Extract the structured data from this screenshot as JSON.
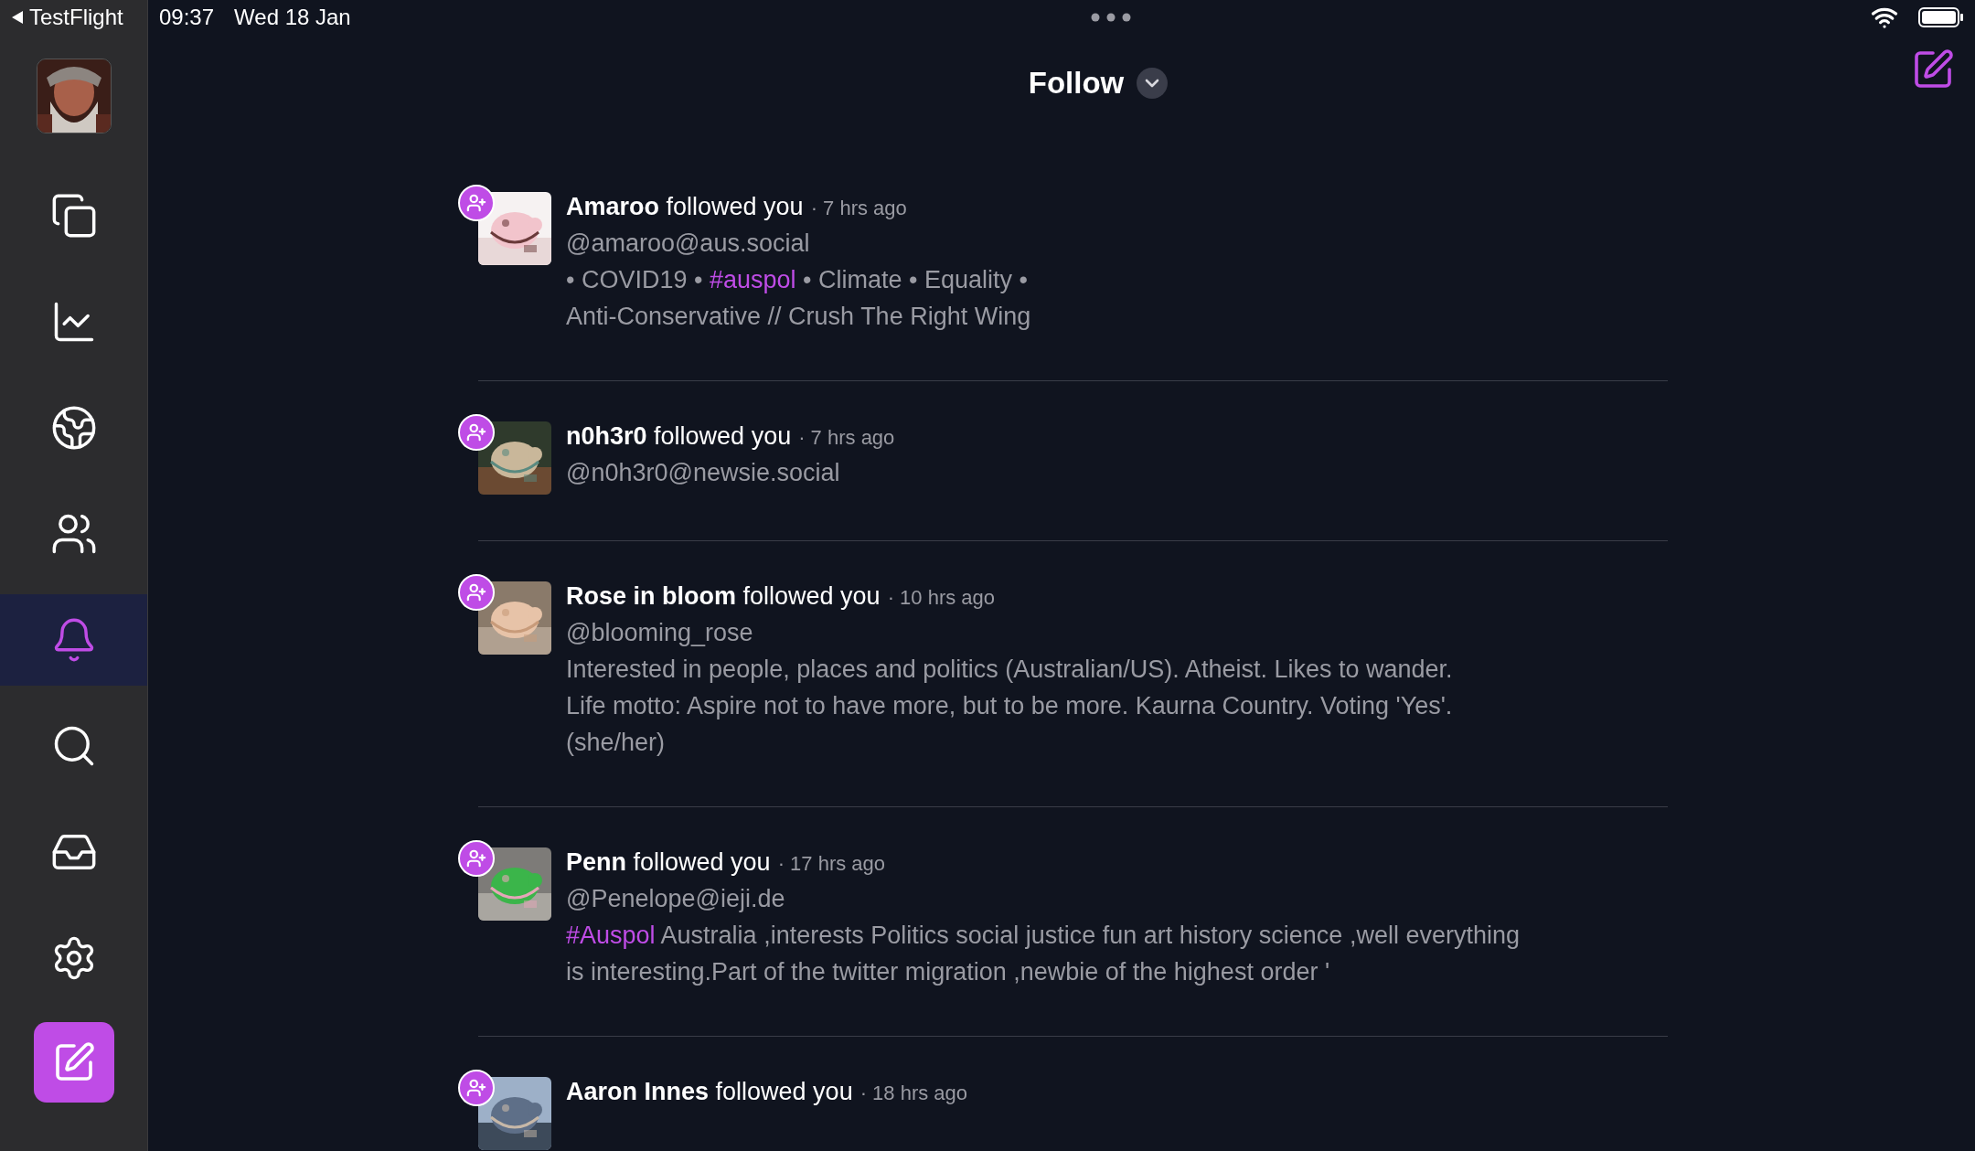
{
  "status_bar": {
    "back_label": "TestFlight",
    "time": "09:37",
    "date": "Wed 18 Jan"
  },
  "header": {
    "title": "Follow"
  },
  "sidebar": {
    "items": [
      {
        "kind": "timelines",
        "selected": false
      },
      {
        "kind": "trending",
        "selected": false
      },
      {
        "kind": "explore",
        "selected": false
      },
      {
        "kind": "people",
        "selected": false
      },
      {
        "kind": "notifications",
        "selected": true
      },
      {
        "kind": "search",
        "selected": false
      },
      {
        "kind": "inbox",
        "selected": false
      },
      {
        "kind": "settings",
        "selected": false
      }
    ]
  },
  "notifications": [
    {
      "name": "Amaroo",
      "action": "followed you",
      "time": "· 7 hrs ago",
      "handle": "@amaroo@aus.social",
      "bio": [
        [
          {
            "text": "• COVID19 • ",
            "kind": "text"
          },
          {
            "text": "#auspol",
            "kind": "hashtag"
          },
          {
            "text": " • Climate • Equality •",
            "kind": "text"
          }
        ],
        [
          {
            "text": "Anti-Conservative // Crush The Right Wing",
            "kind": "text"
          }
        ]
      ]
    },
    {
      "name": "n0h3r0",
      "action": "followed you",
      "time": "· 7 hrs ago",
      "handle": "@n0h3r0@newsie.social"
    },
    {
      "name": "Rose in bloom",
      "action": "followed you",
      "time": "· 10 hrs ago",
      "handle": "@blooming_rose",
      "bio": [
        [
          {
            "text": "Interested in people, places and politics (Australian/US). Atheist. Likes to wander.",
            "kind": "text"
          }
        ],
        [
          {
            "text": "Life motto: Aspire not to have more, but to be more. Kaurna Country. Voting 'Yes'.",
            "kind": "text"
          }
        ],
        [
          {
            "text": "(she/her)",
            "kind": "text"
          }
        ]
      ]
    },
    {
      "name": "Penn",
      "action": "followed you",
      "time": "· 17 hrs ago",
      "handle": "@Penelope@ieji.de",
      "bio": [
        [
          {
            "text": "#Auspol",
            "kind": "hashtag"
          },
          {
            "text": " Australia ,interests Politics social justice fun art history science ,well everything",
            "kind": "text"
          }
        ],
        [
          {
            "text": "is interesting.Part of the twitter migration ,newbie of the highest order '",
            "kind": "text"
          }
        ]
      ]
    },
    {
      "name": "Aaron Innes",
      "action": "followed you",
      "time": "· 18 hrs ago"
    }
  ]
}
